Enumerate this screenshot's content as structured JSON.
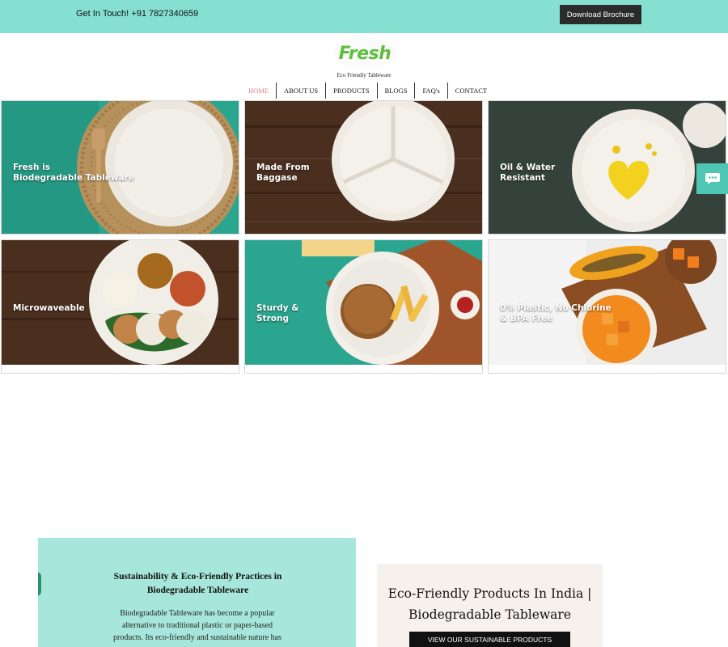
{
  "topbar": {
    "contact_text": "Get In Touch! +91 7827340659",
    "brochure_button": "Download Brochure",
    "background": "#86e0d2"
  },
  "brand": {
    "logo_text": "Fresh",
    "tagline": "Eco Friendly Tableware",
    "logo_color": "#5fbf3c"
  },
  "nav": {
    "items": [
      {
        "label": "HOME",
        "active": true
      },
      {
        "label": "ABOUT US",
        "active": false
      },
      {
        "label": "PRODUCTS",
        "active": false
      },
      {
        "label": "BLOGS",
        "active": false
      },
      {
        "label": "FAQ's",
        "active": false
      },
      {
        "label": "CONTACT",
        "active": false
      }
    ],
    "active_color": "#d9828a"
  },
  "tiles": [
    {
      "caption_line1": "Fresh is",
      "caption_line2": "Biodegradable Tableware",
      "background": "#2aa58f"
    },
    {
      "caption_line1": "Made From",
      "caption_line2": "Baggase",
      "background": "#4a2e1e"
    },
    {
      "caption_line1": "Oil & Water",
      "caption_line2": "Resistant",
      "background": "#3b4a44"
    },
    {
      "caption_line1": "Microwaveable",
      "caption_line2": "",
      "background": "#4a2e1e"
    },
    {
      "caption_line1": "Sturdy &",
      "caption_line2": "Strong",
      "background": "#2aa58f"
    },
    {
      "caption_line1": "0% Plastic, No Chlorine",
      "caption_line2": "& BPA Free",
      "background": "#ededed"
    }
  ],
  "chat": {
    "icon": "chat-bubble-icon",
    "color": "#4fc6b3"
  },
  "sustainability": {
    "heading_line1": "Sustainability & Eco-Friendly Practices in",
    "heading_line2": "Biodegradable Tableware",
    "body_line1": "Biodegradable Tableware has become a popular",
    "body_line2": "alternative to traditional plastic or paper-based",
    "body_line3": "products. Its eco-friendly and sustainable nature has",
    "background": "#a7e7db"
  },
  "eco_products": {
    "title_line1": "Eco-Friendly Products In India |",
    "title_line2": "Biodegradable Tableware",
    "button_label": "VIEW OUR SUSTAINABLE PRODUCTS",
    "background": "#f7f1ed"
  }
}
